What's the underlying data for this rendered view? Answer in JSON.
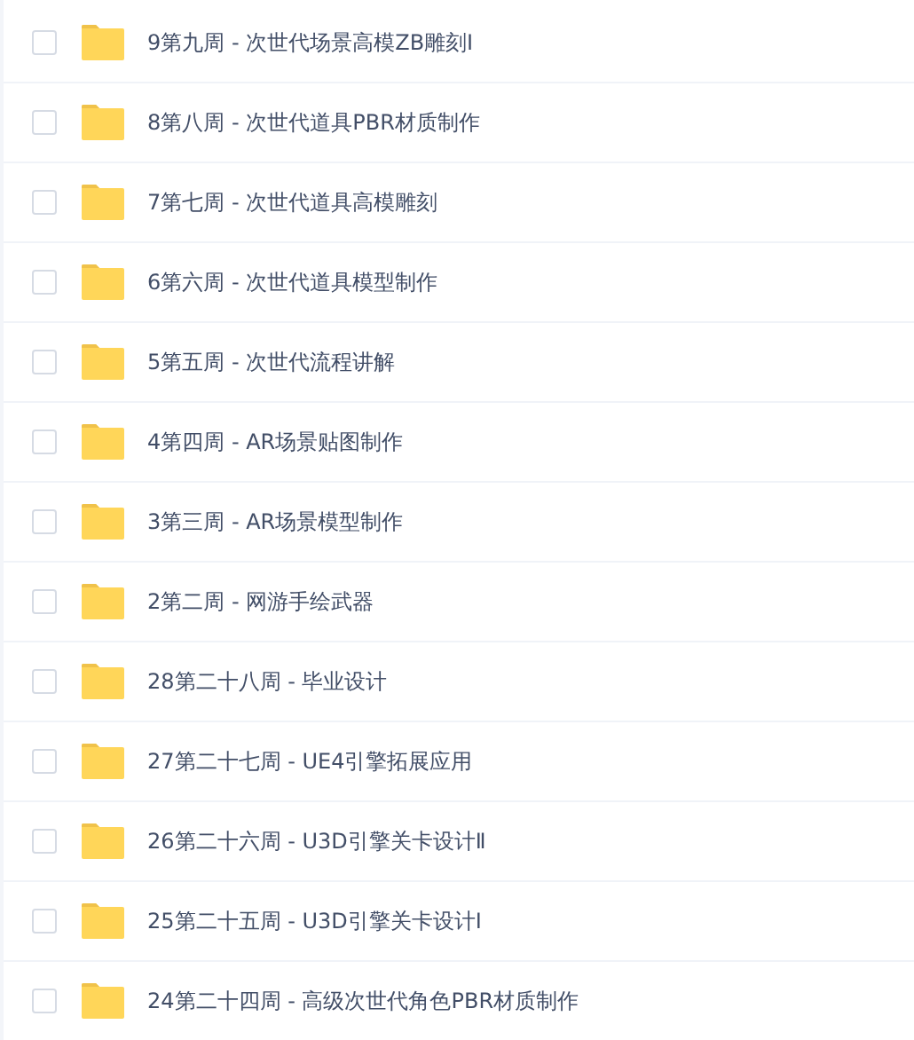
{
  "files": [
    {
      "name": "9第九周 - 次世代场景高模ZB雕刻Ⅰ",
      "checked": false
    },
    {
      "name": "8第八周 - 次世代道具PBR材质制作",
      "checked": false
    },
    {
      "name": "7第七周 - 次世代道具高模雕刻",
      "checked": false
    },
    {
      "name": "6第六周 - 次世代道具模型制作",
      "checked": false
    },
    {
      "name": "5第五周 - 次世代流程讲解",
      "checked": false
    },
    {
      "name": "4第四周 - AR场景贴图制作",
      "checked": false
    },
    {
      "name": "3第三周 - AR场景模型制作",
      "checked": false
    },
    {
      "name": "2第二周 - 网游手绘武器",
      "checked": false
    },
    {
      "name": "28第二十八周 - 毕业设计",
      "checked": false
    },
    {
      "name": "27第二十七周 - UE4引擎拓展应用",
      "checked": false
    },
    {
      "name": "26第二十六周 - U3D引擎关卡设计Ⅱ",
      "checked": false
    },
    {
      "name": "25第二十五周 - U3D引擎关卡设计Ⅰ",
      "checked": false
    },
    {
      "name": "24第二十四周 - 高级次世代角色PBR材质制作",
      "checked": false
    }
  ]
}
